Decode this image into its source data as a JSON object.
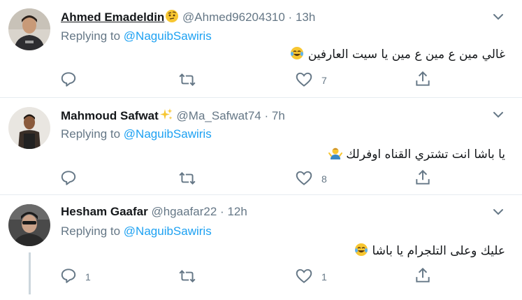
{
  "colors": {
    "link": "#1da1f2",
    "muted": "#657786",
    "text": "#14171a",
    "divider": "#e6ecf0"
  },
  "tweets": [
    {
      "name": "Ahmed Emadeldin",
      "name_emoji": "face-with-raised-eyebrow",
      "handle": "@Ahmed96204310",
      "time": "13h",
      "replying_prefix": "Replying to",
      "replying_to": "@NaguibSawiris",
      "text": "غالي مين ع مين ع مين يا سيت العارفين",
      "text_emoji": "face-with-tears-of-joy",
      "reply_count": "",
      "retweet_count": "",
      "like_count": "7"
    },
    {
      "name": "Mahmoud Safwat",
      "name_emoji": "sparkles",
      "handle": "@Ma_Safwat74",
      "time": "7h",
      "replying_prefix": "Replying to",
      "replying_to": "@NaguibSawiris",
      "text": "يا باشا انت تشتري القناه اوفرلك",
      "text_emoji": "person-shrugging",
      "reply_count": "",
      "retweet_count": "",
      "like_count": "8"
    },
    {
      "name": "Hesham Gaafar",
      "name_emoji": "",
      "handle": "@hgaafar22",
      "time": "12h",
      "replying_prefix": "Replying to",
      "replying_to": "@NaguibSawiris",
      "text": "عليك وعلى التلجرام يا باشا",
      "text_emoji": "face-with-tears-of-joy",
      "reply_count": "1",
      "retweet_count": "",
      "like_count": "1"
    }
  ]
}
